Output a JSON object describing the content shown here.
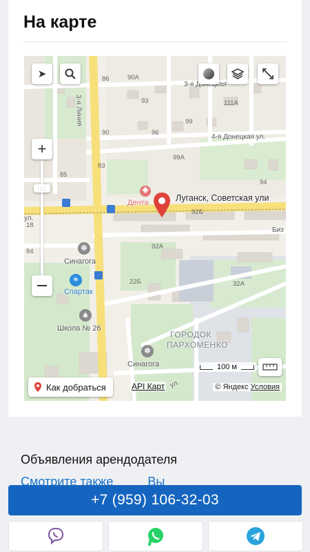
{
  "map_section": {
    "title": "На карте",
    "marker_address": "Луганск, Советская ули",
    "route_button": "Как добраться",
    "api_link": "API Карт",
    "copyright": "© Яндекс",
    "terms": "Условия",
    "scale": "100 м",
    "streets": [
      "3-я Донецкая",
      "4-я Донецкая ул.",
      "3-я Линия",
      "ул.",
      "Биз",
      "ул."
    ],
    "house_numbers": [
      "86",
      "90А",
      "93",
      "96",
      "90",
      "111А",
      "99А",
      "83",
      "85",
      "92Б",
      "92А",
      "84",
      "22Б",
      "32А",
      "99",
      "94",
      "18"
    ],
    "pois": [
      "Дента",
      "Синагога",
      "Спартак",
      "Школа № 26",
      "ГОРОДОК",
      "ПАРХОМЕНКО",
      "Синагога"
    ],
    "icons": [
      "location-arrow-icon",
      "search-icon",
      "traffic-icon",
      "layers-icon",
      "fullscreen-icon",
      "zoom-in-icon",
      "zoom-out-icon",
      "map-pin-icon",
      "ruler-icon"
    ]
  },
  "landlord": {
    "title": "Объявления арендодателя"
  },
  "see_also": {
    "label": "Смотрите также",
    "extra": "Вы"
  },
  "contact": {
    "phone": "+7 (959) 106-32-03",
    "messengers": [
      "viber",
      "whatsapp",
      "telegram"
    ]
  },
  "colors": {
    "accent": "#1565c0",
    "link": "#1a73c9",
    "pin": "#e0423a",
    "whatsapp": "#25d366",
    "telegram": "#2aa3dd",
    "viber": "#7b519d"
  }
}
